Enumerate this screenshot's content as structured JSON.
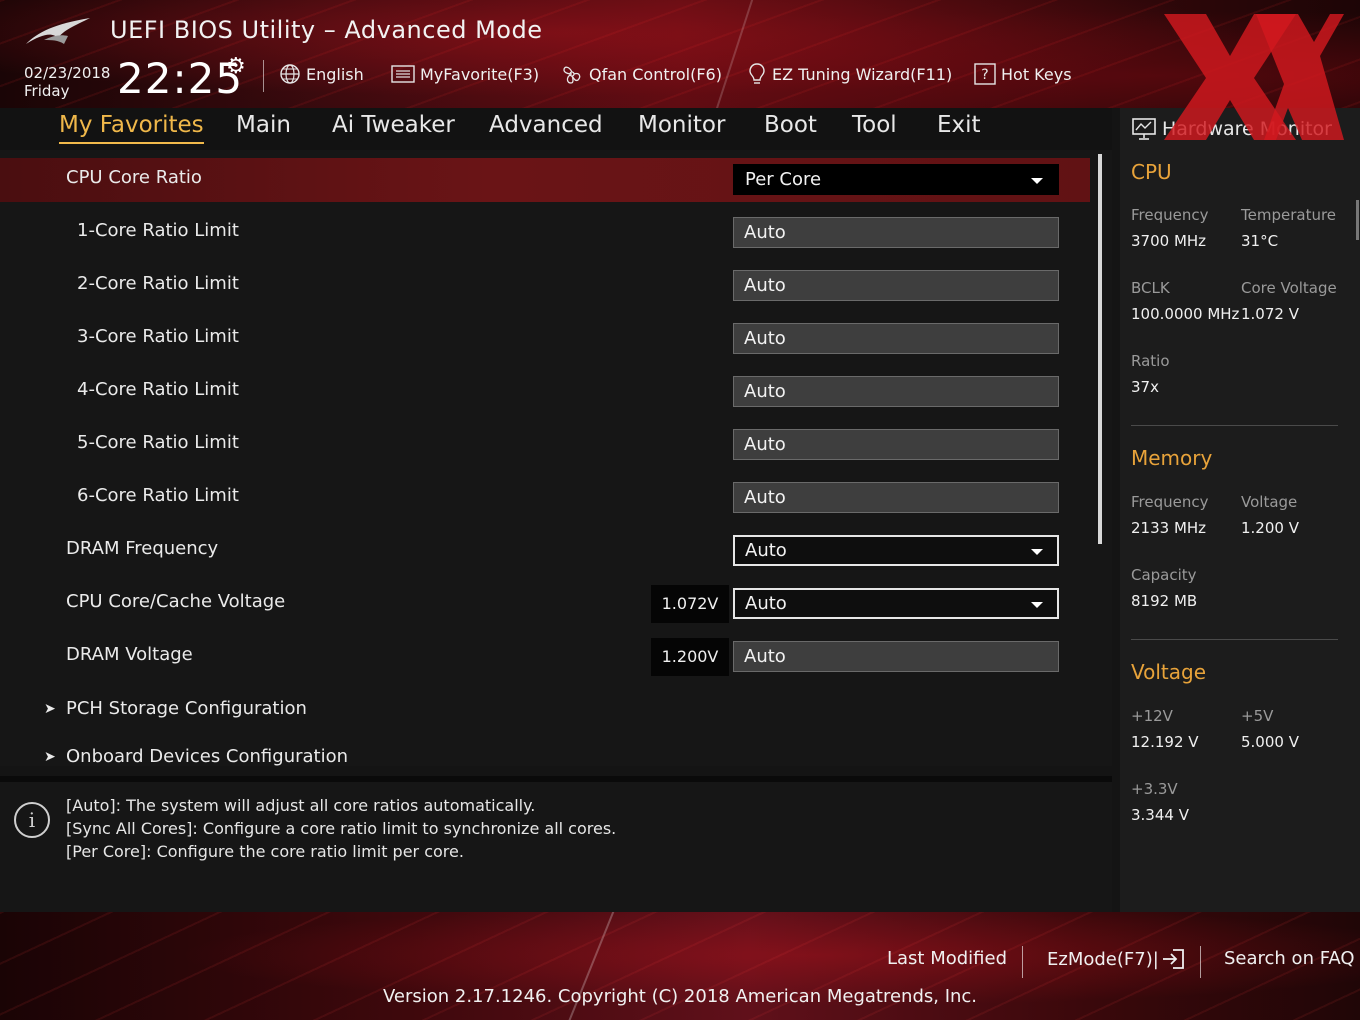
{
  "header": {
    "title": "UEFI BIOS Utility – Advanced Mode",
    "date": "02/23/2018",
    "day": "Friday",
    "time": "22:25",
    "items": [
      {
        "label": "English",
        "icon": "globe-icon"
      },
      {
        "label": "MyFavorite(F3)",
        "icon": "favorite-list-icon"
      },
      {
        "label": "Qfan Control(F6)",
        "icon": "fan-icon"
      },
      {
        "label": "EZ Tuning Wizard(F11)",
        "icon": "lightbulb-icon"
      },
      {
        "label": "Hot Keys",
        "icon": "question-box-icon"
      }
    ]
  },
  "nav": {
    "tabs": [
      "My Favorites",
      "Main",
      "Ai Tweaker",
      "Advanced",
      "Monitor",
      "Boot",
      "Tool",
      "Exit"
    ],
    "active": "My Favorites"
  },
  "settings": [
    {
      "label": "CPU Core Ratio",
      "value": "Per Core"
    },
    {
      "label": "1-Core Ratio Limit",
      "value": "Auto"
    },
    {
      "label": "2-Core Ratio Limit",
      "value": "Auto"
    },
    {
      "label": "3-Core Ratio Limit",
      "value": "Auto"
    },
    {
      "label": "4-Core Ratio Limit",
      "value": "Auto"
    },
    {
      "label": "5-Core Ratio Limit",
      "value": "Auto"
    },
    {
      "label": "6-Core Ratio Limit",
      "value": "Auto"
    },
    {
      "label": "DRAM Frequency",
      "value": "Auto"
    },
    {
      "label": "CPU Core/Cache Voltage",
      "reading": "1.072V",
      "value": "Auto"
    },
    {
      "label": "DRAM Voltage",
      "reading": "1.200V",
      "value": "Auto"
    }
  ],
  "submenus": [
    "PCH Storage Configuration",
    "Onboard Devices Configuration"
  ],
  "help": {
    "lines": [
      "[Auto]: The system will adjust all core ratios automatically.",
      "[Sync All Cores]: Configure a core ratio limit to synchronize all cores.",
      "[Per Core]: Configure the core ratio limit per core."
    ]
  },
  "hardware_monitor": {
    "title": "Hardware Monitor",
    "cpu": {
      "heading": "CPU",
      "frequency_label": "Frequency",
      "frequency": "3700 MHz",
      "temperature_label": "Temperature",
      "temperature": "31°C",
      "bclk_label": "BCLK",
      "bclk": "100.0000 MHz",
      "core_voltage_label": "Core Voltage",
      "core_voltage": "1.072 V",
      "ratio_label": "Ratio",
      "ratio": "37x"
    },
    "memory": {
      "heading": "Memory",
      "frequency_label": "Frequency",
      "frequency": "2133 MHz",
      "voltage_label": "Voltage",
      "voltage": "1.200 V",
      "capacity_label": "Capacity",
      "capacity": "8192 MB"
    },
    "voltage": {
      "heading": "Voltage",
      "v12_label": "+12V",
      "v12": "12.192 V",
      "v5_label": "+5V",
      "v5": "5.000 V",
      "v33_label": "+3.3V",
      "v33": "3.344 V"
    }
  },
  "footer": {
    "last_modified": "Last Modified",
    "ezmode": "EzMode(F7)|",
    "search": "Search on FAQ",
    "version": "Version 2.17.1246. Copyright (C) 2018 American Megatrends, Inc."
  },
  "colors": {
    "accent": "#f0b84a",
    "selected_row": "#6a1416",
    "monitor_heading": "#e8a33a"
  }
}
